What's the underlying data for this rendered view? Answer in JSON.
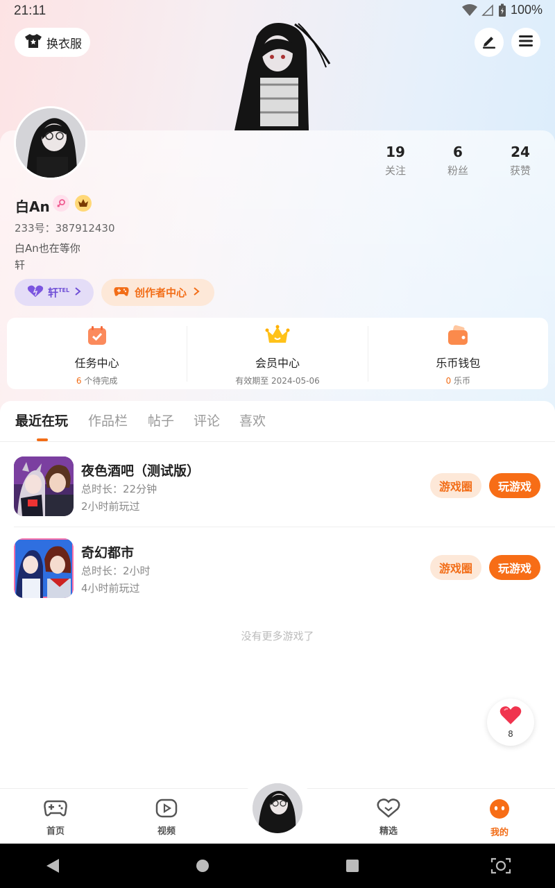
{
  "status_bar": {
    "time": "21:11",
    "battery": "100%"
  },
  "top": {
    "outfit_label": "换衣服"
  },
  "profile": {
    "name": "白An",
    "uid": "233号：387912430",
    "bio_line1": "白An也在等你",
    "bio_line2": "轩",
    "stats": [
      {
        "num": "19",
        "label": "关注"
      },
      {
        "num": "6",
        "label": "粉丝"
      },
      {
        "num": "24",
        "label": "获赞"
      }
    ],
    "pill_purple": {
      "label": "轩",
      "sup": "TEL"
    },
    "pill_orange": {
      "label": "创作者中心"
    }
  },
  "services": [
    {
      "title": "任务中心",
      "highlight": "6",
      "sub": " 个待完成"
    },
    {
      "title": "会员中心",
      "highlight": "",
      "sub": "有效期至 2024-05-06"
    },
    {
      "title": "乐币钱包",
      "highlight": "0",
      "sub": " 乐币"
    }
  ],
  "tabs": [
    "最近在玩",
    "作品栏",
    "帖子",
    "评论",
    "喜欢"
  ],
  "games": [
    {
      "name": "夜色酒吧（测试版）",
      "duration": "总时长：22分钟",
      "last_played": "2小时前玩过",
      "circle_label": "游戏圈",
      "play_label": "玩游戏"
    },
    {
      "name": "奇幻都市",
      "duration": "总时长：2小时",
      "last_played": "4小时前玩过",
      "circle_label": "游戏圈",
      "play_label": "玩游戏"
    }
  ],
  "no_more": "没有更多游戏了",
  "like_count": "8",
  "bottom_nav": [
    {
      "label": "首页",
      "icon": "gamepad-icon"
    },
    {
      "label": "视频",
      "icon": "play-icon"
    },
    {
      "label": "精选",
      "icon": "heart-chat-icon"
    },
    {
      "label": "我的",
      "icon": "face-icon"
    }
  ],
  "colors": {
    "accent": "#f76d16",
    "purple": "#6f4fd6"
  }
}
